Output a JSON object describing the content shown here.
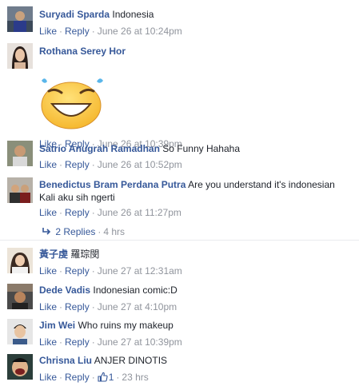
{
  "actions": {
    "like": "Like",
    "reply": "Reply",
    "dot": "·"
  },
  "comments": [
    {
      "author": "Suryadi Sparda",
      "text": "Indonesia",
      "time": "June 26 at 10:24pm"
    },
    {
      "author": "Rothana Serey Hor",
      "text": "",
      "time": "June 26 at 10:39pm"
    },
    {
      "author": "Satrio Anugrah Ramadhan",
      "text": "So Funny Hahaha",
      "time": "June 26 at 10:52pm"
    },
    {
      "author": "Benedictus Bram Perdana Putra",
      "text": "Are you understand it's indonesian",
      "text2": "Kali aku sih ngerti",
      "time": "June 26 at 11:27pm"
    },
    {
      "author": "黃子虔",
      "text": "羅琮閔",
      "time": "June 27 at 12:31am"
    },
    {
      "author": "Dede Vadis",
      "text": "Indonesian comic:D",
      "time": "June 27 at 4:10pm"
    },
    {
      "author": "Jim Wei",
      "text": "Who ruins my makeup",
      "time": "June 27 at 10:39pm"
    },
    {
      "author": "Chrisna Liu",
      "text": "ANJER DINOTIS",
      "like_count": "1",
      "time": "23 hrs"
    }
  ],
  "replies": {
    "label": "2 Replies",
    "ago": "4 hrs"
  },
  "colors": {
    "link": "#365899",
    "meta": "#90949c",
    "text": "#1d2129"
  }
}
